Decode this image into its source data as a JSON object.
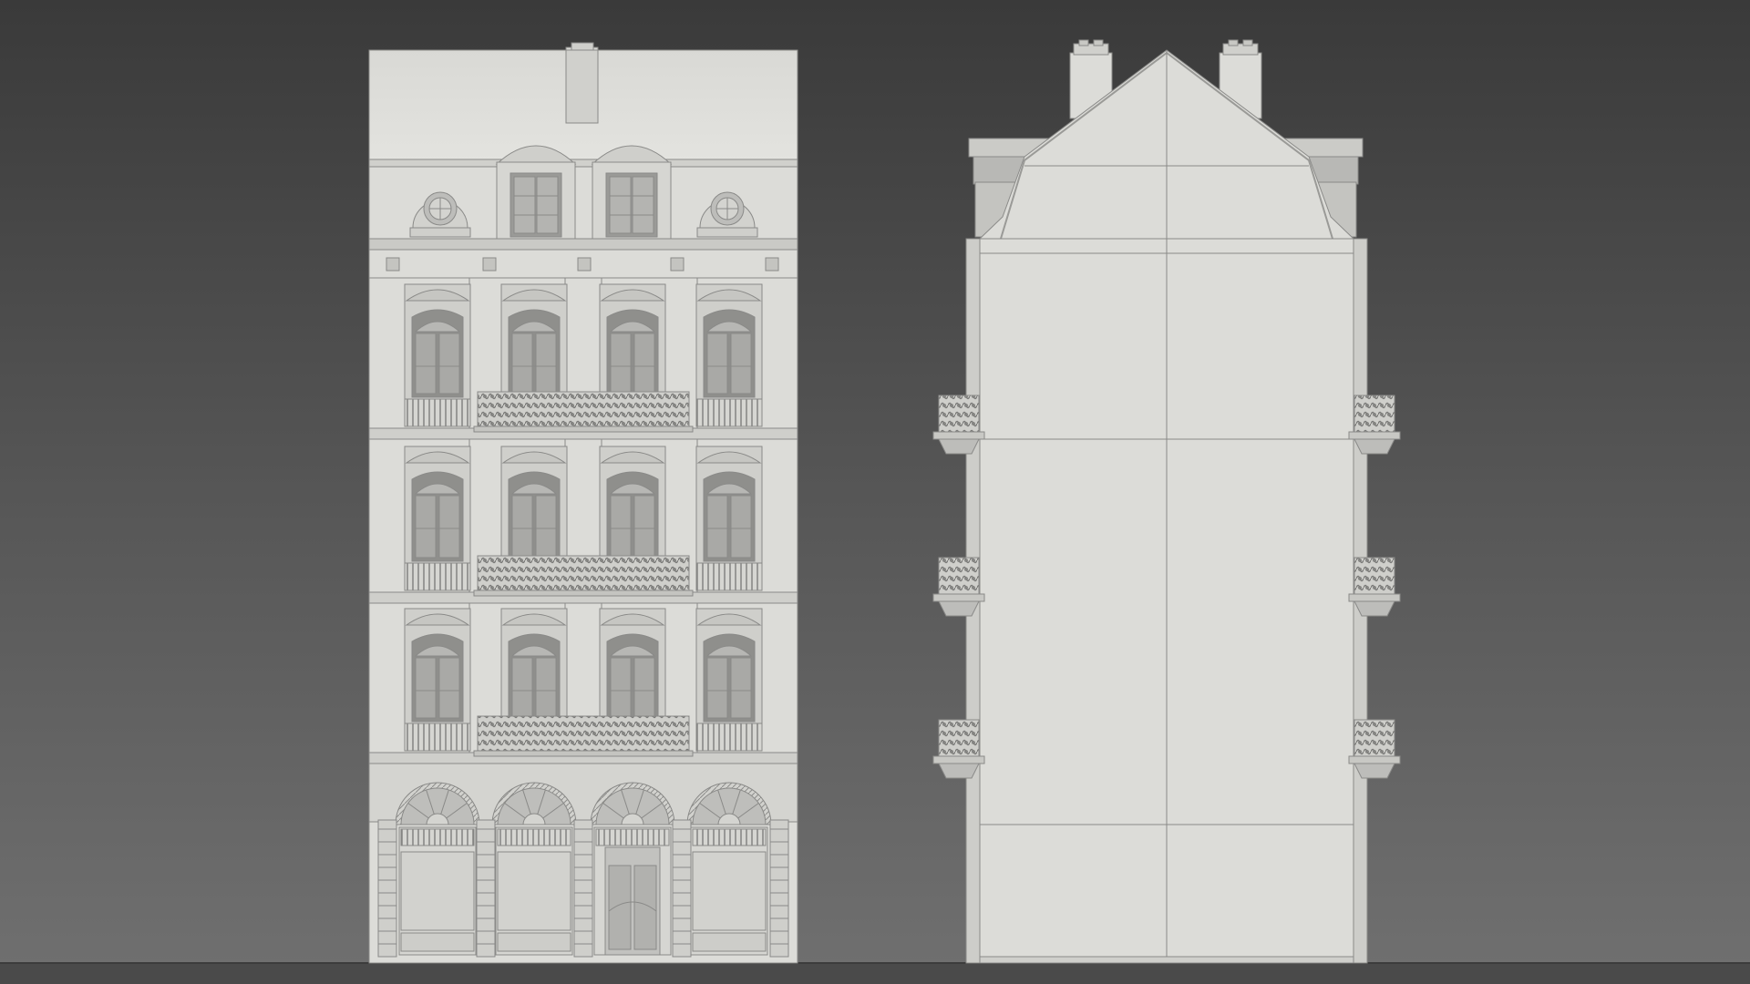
{
  "render": {
    "title": "",
    "background_top": "#3b3b3b",
    "background_bottom": "#6e6e6e",
    "ground_color": "#4a4a4a",
    "model_color": "#dcdcd8",
    "line_color": "#8a8a88",
    "shade_color": "#9a9a97",
    "dark_color": "#7c7c7a"
  },
  "views": [
    {
      "id": "front-elevation",
      "label": ""
    },
    {
      "id": "side-elevation",
      "label": ""
    }
  ]
}
